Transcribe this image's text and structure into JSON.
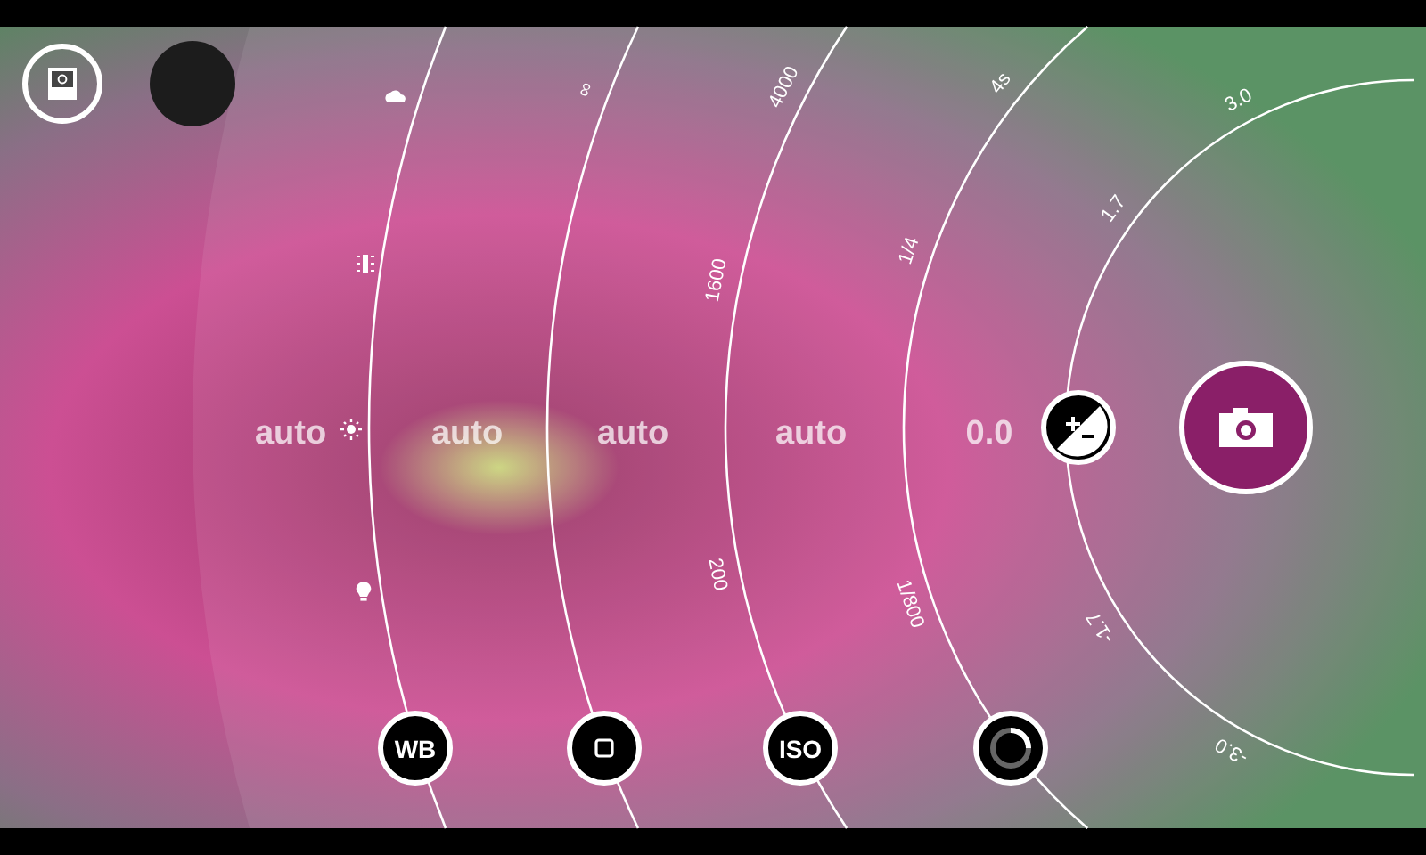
{
  "dials": [
    {
      "kind": "white_balance",
      "value": "auto",
      "button": "WB"
    },
    {
      "kind": "focus",
      "value": "auto",
      "ticks": [
        "∞"
      ]
    },
    {
      "kind": "iso",
      "value": "auto",
      "button": "ISO",
      "ticks": [
        "4000",
        "1600",
        "200"
      ]
    },
    {
      "kind": "shutter",
      "value": "auto",
      "ticks": [
        "4s",
        "1/4",
        "1/800"
      ]
    },
    {
      "kind": "exposure",
      "value": "0.0",
      "ticks": [
        "3.0",
        "1.7",
        "-1.7",
        "-3.0"
      ]
    }
  ]
}
